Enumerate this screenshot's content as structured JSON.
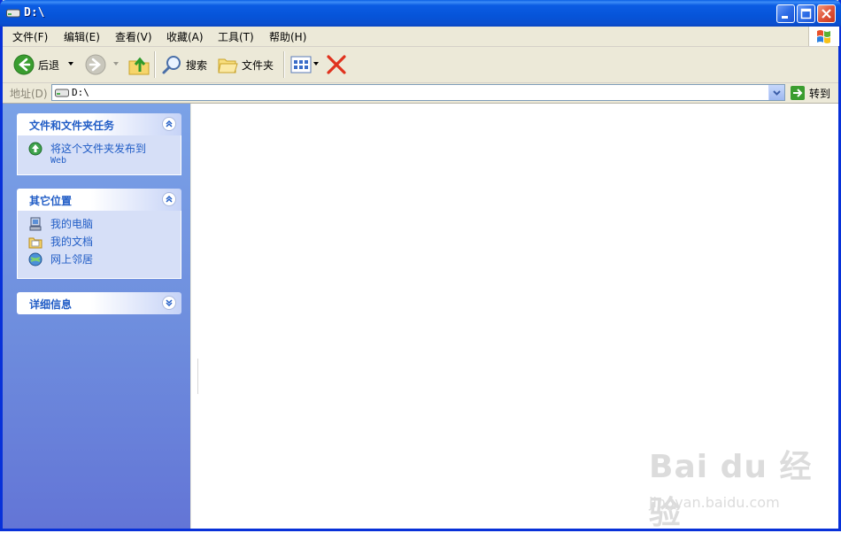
{
  "window": {
    "title": "D:\\",
    "colors": {
      "titlebar": "#0a54d9",
      "close": "#e0553a",
      "sidebar": "#6f8fde",
      "link": "#215dc6"
    }
  },
  "menu": {
    "items": [
      "文件(F)",
      "编辑(E)",
      "查看(V)",
      "收藏(A)",
      "工具(T)",
      "帮助(H)"
    ]
  },
  "toolbar": {
    "back_label": "后退",
    "search_label": "搜索",
    "folders_label": "文件夹",
    "icons": [
      "back-arrow-icon",
      "forward-arrow-icon",
      "up-folder-icon",
      "search-icon",
      "folders-icon",
      "views-icon",
      "delete-x-icon"
    ]
  },
  "address": {
    "label": "地址(D)",
    "value": "D:\\",
    "go_label": "转到"
  },
  "sidebar": {
    "panels": [
      {
        "title": "文件和文件夹任务",
        "tasks": [
          {
            "label": "将这个文件夹发布到",
            "sub": "Web",
            "icon": "publish-web-icon"
          }
        ]
      },
      {
        "title": "其它位置",
        "tasks": [
          {
            "label": "我的电脑",
            "icon": "my-computer-icon"
          },
          {
            "label": "我的文档",
            "icon": "my-documents-icon"
          },
          {
            "label": "网上邻居",
            "icon": "network-places-icon"
          }
        ]
      },
      {
        "title": "详细信息",
        "tasks": []
      }
    ]
  },
  "watermark": {
    "brand": "Bai du 经验",
    "url": "jingyan.baidu.com"
  }
}
